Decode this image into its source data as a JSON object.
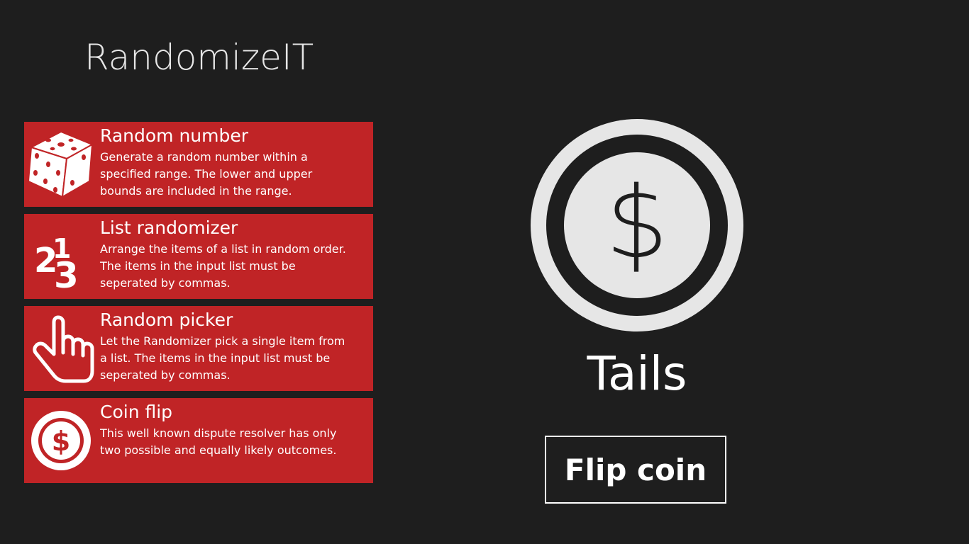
{
  "app": {
    "title": "RandomizeIT"
  },
  "tiles": [
    {
      "title": "Random number",
      "description": "Generate a random number within a specified range. The lower and upper bounds are included in the range.",
      "icon": "dice-icon"
    },
    {
      "title": "List randomizer",
      "description": "Arrange the items of a list in random order. The items in the input list must be seperated by commas.",
      "icon": "numbers-123-icon",
      "icon_text": {
        "a": "2",
        "b": "1",
        "c": "3"
      }
    },
    {
      "title": "Random picker",
      "description": "Let the Randomizer pick a single item from a list. The items in the input list must be seperated by commas.",
      "icon": "pointing-hand-icon"
    },
    {
      "title": "Coin flip",
      "description": "This well known dispute resolver has only two possible and equally likely outcomes.",
      "icon": "coin-icon",
      "icon_text": "$"
    }
  ],
  "coin_flip": {
    "coin_symbol": "$",
    "result": "Tails",
    "button_label": "Flip coin"
  },
  "colors": {
    "background": "#1e1e1e",
    "tile": "#c02426",
    "coin_face": "#e6e6e6",
    "text": "#ffffff"
  }
}
